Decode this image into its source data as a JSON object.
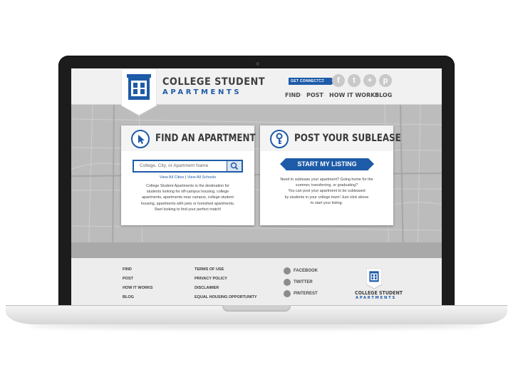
{
  "logo": {
    "line1": "COLLEGE STUDENT",
    "line2": "APARTMENTS"
  },
  "header": {
    "get_connected": "GET CONNECTED",
    "social_icons": [
      "facebook-icon",
      "twitter-icon",
      "google-plus-icon",
      "pinterest-icon"
    ],
    "nav": [
      "FIND",
      "POST",
      "HOW IT WORKS",
      "BLOG"
    ]
  },
  "find": {
    "title": "FIND AN APARTMENT",
    "search_placeholder": "College, City, or Apartment Name",
    "link_cities": "View All Cities",
    "link_separator": "|",
    "link_schools": "View All Schools",
    "body": [
      "College Student Apartments is the destination for",
      "students looking for off-campus housing, college",
      "apartments, apartments near campus, college student",
      "housing, apartments with pets or furnished apartments.",
      "Start looking to find your perfect match!"
    ]
  },
  "post": {
    "title": "POST YOUR SUBLEASE",
    "button": "START MY LISTING",
    "body": [
      "Need to sublease your apartment? Going home for the",
      "summer, transferring, or graduating?",
      "You can post your apartment to be subleased",
      "by students in your college town! Just click above",
      "to start your listing."
    ]
  },
  "footer": {
    "col1": [
      "FIND",
      "POST",
      "HOW IT WORKS",
      "BLOG"
    ],
    "col2": [
      "TERMS OF USE",
      "PRIVACY POLICY",
      "DISCLAIMER",
      "EQUAL HOUSING OPPORTUNITY"
    ],
    "social": [
      "FACEBOOK",
      "TWITTER",
      "PINTEREST"
    ]
  },
  "colors": {
    "brand_blue": "#1e5ba8",
    "map_gray": "#bcbcbc",
    "frame": "#1c1c1c"
  }
}
